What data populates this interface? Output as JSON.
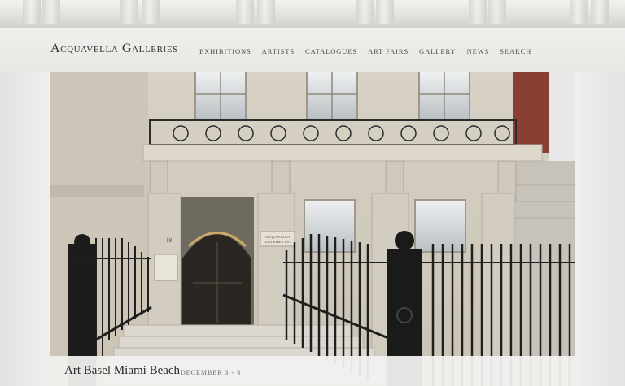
{
  "site": {
    "title": "Acquavella Galleries"
  },
  "nav": {
    "items": [
      {
        "label": "Exhibitions"
      },
      {
        "label": "Artists"
      },
      {
        "label": "Catalogues"
      },
      {
        "label": "Art Fairs"
      },
      {
        "label": "Gallery"
      },
      {
        "label": "News"
      },
      {
        "label": "Search"
      }
    ]
  },
  "hero": {
    "image": "gallery-facade-photo",
    "sign_text": "ACQUAVELLA GALLERIES INC.",
    "street_number": "18"
  },
  "feature": {
    "title": "Art Basel Miami Beach",
    "dates": "December 3 - 6"
  },
  "colors": {
    "background": "#e9e8e6",
    "text": "#2f2f2f",
    "nav_text": "#4a4a4a",
    "caption_bar": "#f2f1ef"
  }
}
